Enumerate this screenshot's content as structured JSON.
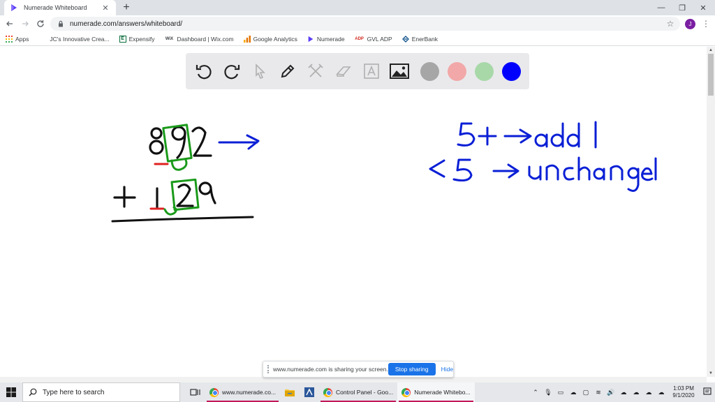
{
  "browser": {
    "tab_title": "Numerade Whiteboard",
    "tab_close": "✕",
    "new_tab": "+",
    "url": "numerade.com/answers/whiteboard/",
    "profile_initial": "J",
    "window_controls": {
      "minimize": "—",
      "maximize": "❐",
      "close": "✕"
    }
  },
  "bookmarks": [
    {
      "label": "Apps",
      "icon": "apps-grid-icon"
    },
    {
      "label": "JC's Innovative Crea...",
      "icon": "blank-page-icon"
    },
    {
      "label": "Expensify",
      "icon": "expensify-icon"
    },
    {
      "label": "Dashboard | Wix.com",
      "icon": "wix-icon"
    },
    {
      "label": "Google Analytics",
      "icon": "analytics-icon"
    },
    {
      "label": "Numerade",
      "icon": "numerade-icon"
    },
    {
      "label": "GVL ADP",
      "icon": "adp-icon"
    },
    {
      "label": "EnerBank",
      "icon": "enerbank-icon"
    }
  ],
  "whiteboard": {
    "tools": [
      "undo-icon",
      "redo-icon",
      "pointer-icon",
      "pen-icon",
      "tools-icon",
      "eraser-icon",
      "text-icon",
      "image-icon"
    ],
    "colors": [
      "#a6a6a6",
      "#f2a8a8",
      "#a8d8a8",
      "#0000ff"
    ],
    "ink": {
      "black": "#111111",
      "green": "#1a9a1a",
      "red": "#e02020",
      "blue": "#0a1fd6"
    }
  },
  "share_bar": {
    "message": "www.numerade.com is sharing your screen.",
    "stop_label": "Stop sharing",
    "hide_label": "Hide"
  },
  "taskbar": {
    "search_placeholder": "Type here to search",
    "apps": [
      {
        "label": "www.numerade.co..."
      },
      {
        "label": "Control Panel - Goo..."
      },
      {
        "label": "Numerade Whitebo..."
      }
    ],
    "time": "1:03 PM",
    "date": "9/1/2020"
  }
}
